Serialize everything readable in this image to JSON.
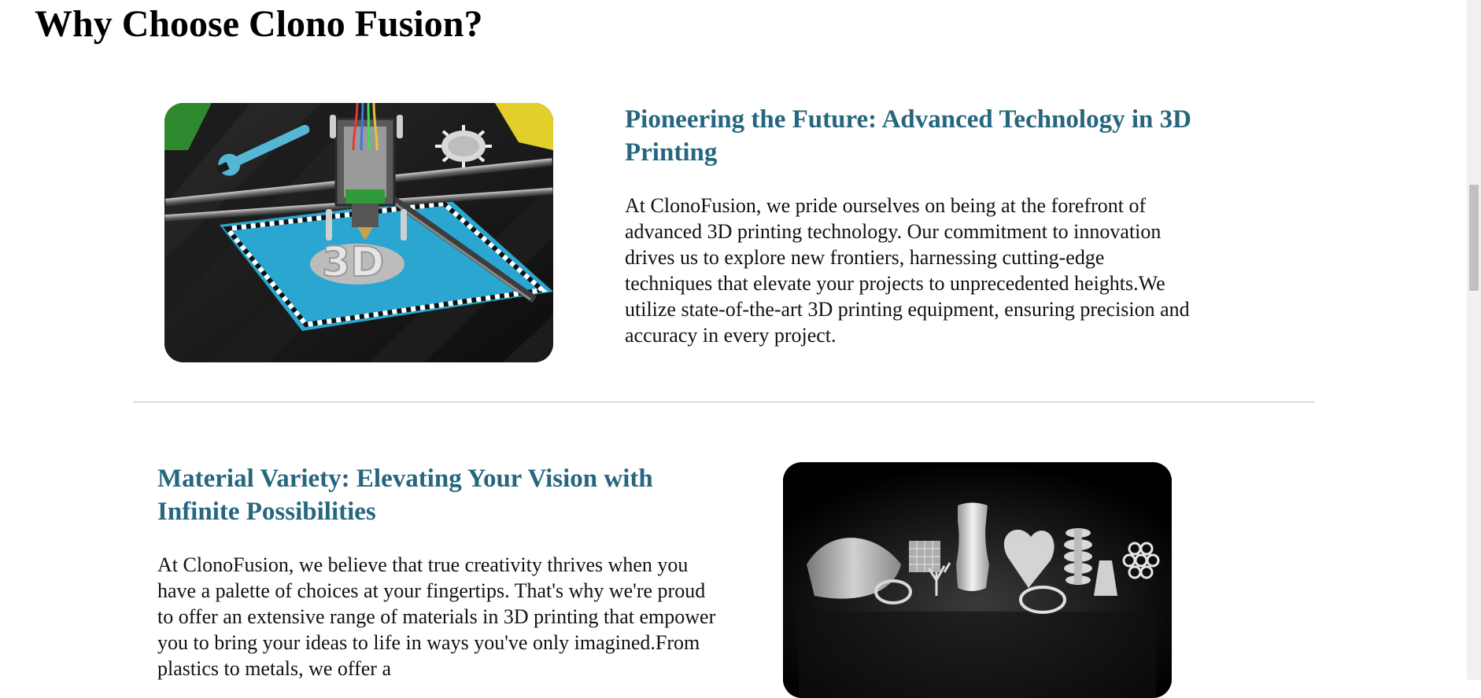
{
  "page": {
    "title": "Why Choose Clono Fusion?"
  },
  "sections": [
    {
      "title": "Pioneering the Future: Advanced Technology in 3D Printing",
      "text": "At ClonoFusion, we pride ourselves on being at the forefront of advanced 3D printing technology. Our commitment to innovation drives us to explore new frontiers, harnessing cutting-edge techniques that elevate your projects to unprecedented heights.We utilize state-of-the-art 3D printing equipment, ensuring precision and accuracy in every project."
    },
    {
      "title": "Material Variety: Elevating Your Vision with Infinite Possibilities",
      "text": "At ClonoFusion, we believe that true creativity thrives when you have a palette of choices at your fingertips. That's why we're proud to offer an extensive range of materials in 3D printing that empower you to bring your ideas to life in ways you've only imagined.From plastics to metals, we offer a"
    }
  ],
  "colors": {
    "heading": "#26667f",
    "divider": "#bdbdbd",
    "print_bed": "#2aa6d0"
  }
}
